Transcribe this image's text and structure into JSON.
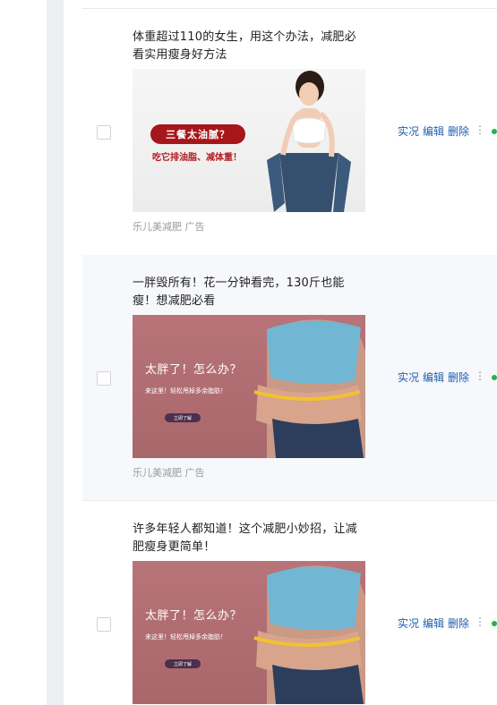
{
  "rows": [
    {
      "title": "体重超过110的女生，用这个办法，减肥必看实用瘦身好方法",
      "image": {
        "pill_text": "三餐太油腻？",
        "sub_text": "吃它排油脂、减体重！"
      },
      "source": "乐儿美减肥 广告",
      "actions": {
        "view": "实况",
        "edit": "编辑",
        "delete": "删除",
        "more": "⋮"
      }
    },
    {
      "title": "一胖毁所有！花一分钟看完，130斤也能瘦！想减肥必看",
      "image": {
        "headline": "太胖了！怎么办？",
        "subline": "来这里！轻松甩掉多余脂肪！",
        "button": "立即了解"
      },
      "source": "乐儿美减肥 广告",
      "actions": {
        "view": "实况",
        "edit": "编辑",
        "delete": "删除",
        "more": "⋮"
      }
    },
    {
      "title": "许多年轻人都知道！这个减肥小妙招，让减肥瘦身更简单！",
      "image": {
        "headline": "太胖了！怎么办？",
        "subline": "来这里！轻松甩掉多余脂肪！",
        "button": "立即了解"
      },
      "actions": {
        "view": "实况",
        "edit": "编辑",
        "delete": "删除",
        "more": "⋮"
      }
    }
  ],
  "colors": {
    "link": "#1d5fb0",
    "status": "#22b14c",
    "alt_row": "#f7f8fb",
    "ad_red": "#a6171b"
  }
}
